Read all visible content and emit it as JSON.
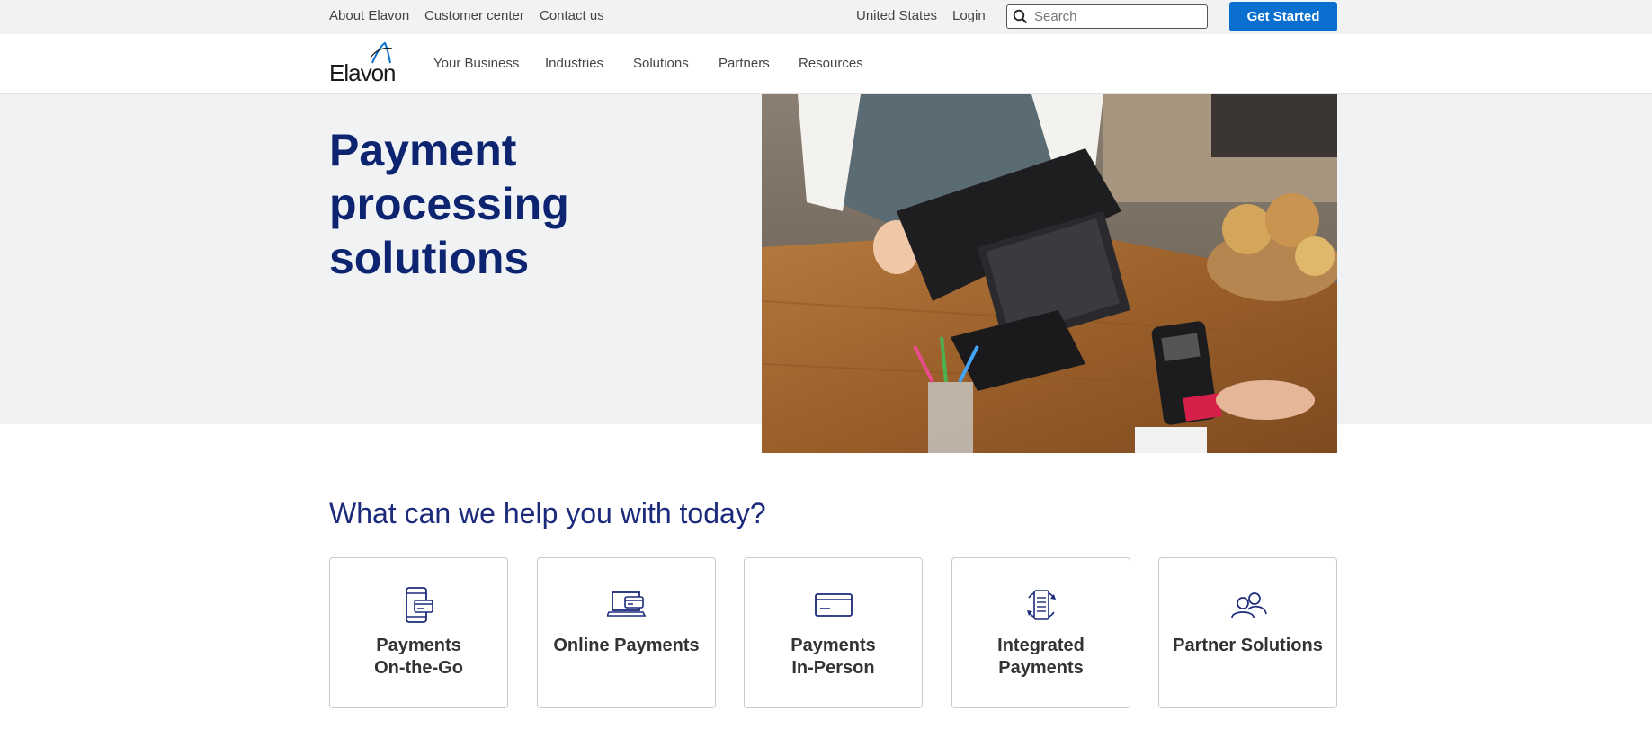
{
  "utility_bar": {
    "links": [
      "About Elavon",
      "Customer center",
      "Contact us"
    ],
    "region": "United States",
    "login": "Login",
    "search_placeholder": "Search",
    "cta": "Get Started"
  },
  "nav": {
    "logo": "Elavon",
    "items": [
      "Your Business",
      "Industries",
      "Solutions",
      "Partners",
      "Resources"
    ]
  },
  "hero": {
    "title_line1": "Payment processing",
    "title_line2": "solutions"
  },
  "help": {
    "heading": "What can we help you with today?",
    "cards": [
      {
        "line1": "Payments",
        "line2": "On-the-Go",
        "icon": "mobile-card-icon"
      },
      {
        "line1": "Online Payments",
        "line2": "",
        "icon": "laptop-card-icon"
      },
      {
        "line1": "Payments",
        "line2": "In-Person",
        "icon": "credit-card-icon"
      },
      {
        "line1": "Integrated",
        "line2": "Payments",
        "icon": "integration-cycle-icon"
      },
      {
        "line1": "Partner Solutions",
        "line2": "",
        "icon": "people-icon"
      }
    ]
  },
  "colors": {
    "brand_blue": "#0a6fce",
    "heading_navy": "#0d2471",
    "band_gray": "#f1f2f4"
  }
}
